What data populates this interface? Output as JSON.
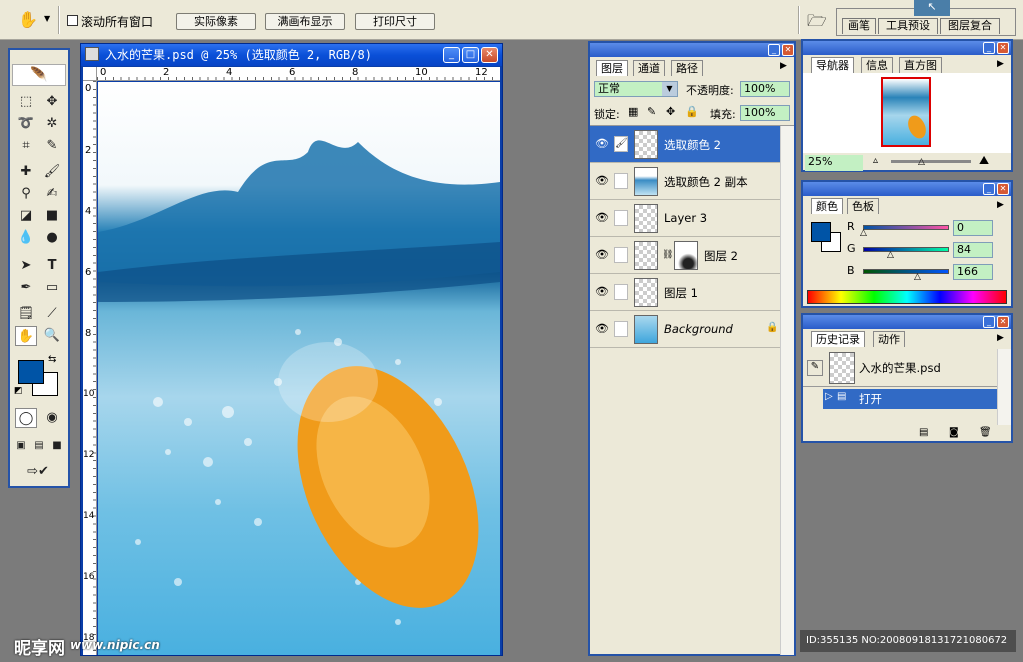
{
  "options_bar": {
    "scroll_all_label": "滚动所有窗口",
    "actual_pixels": "实际像素",
    "fit_screen": "满画布显示",
    "print_size": "打印尺寸",
    "well_tabs": [
      "画笔",
      "工具预设",
      "图层复合"
    ]
  },
  "document": {
    "title": "入水的芒果.psd @ 25% (选取颜色 2, RGB/8)",
    "ruler_top": [
      "0",
      "2",
      "4",
      "6",
      "8",
      "10",
      "12"
    ],
    "ruler_left": [
      "0",
      "2",
      "4",
      "6",
      "8",
      "10",
      "12",
      "14",
      "16",
      "18"
    ]
  },
  "layers_panel": {
    "tabs": [
      "图层",
      "通道",
      "路径"
    ],
    "blend_mode": "正常",
    "opacity_label": "不透明度:",
    "opacity_value": "100%",
    "lock_label": "锁定:",
    "fill_label": "填充:",
    "fill_value": "100%",
    "layers": [
      {
        "name": "选取颜色 2",
        "selected": true
      },
      {
        "name": "选取颜色 2 副本",
        "selected": false
      },
      {
        "name": "Layer 3",
        "selected": false
      },
      {
        "name": "图层 2",
        "selected": false
      },
      {
        "name": "图层 1",
        "selected": false
      },
      {
        "name": "Background",
        "selected": false
      }
    ]
  },
  "navigator_panel": {
    "tabs": [
      "导航器",
      "信息",
      "直方图"
    ],
    "zoom": "25%"
  },
  "color_panel": {
    "tabs": [
      "颜色",
      "色板"
    ],
    "r_label": "R",
    "r_value": "0",
    "g_label": "G",
    "g_value": "84",
    "b_label": "B",
    "b_value": "166",
    "foreground": "#0054a6"
  },
  "history_panel": {
    "tabs": [
      "历史记录",
      "动作"
    ],
    "snapshot": "入水的芒果.psd",
    "steps": [
      "打开"
    ]
  },
  "watermark": {
    "logo": "昵享网",
    "url": "www.nipic.cn",
    "id_text": "ID:355135 NO:20080918131721080672"
  },
  "colors": {
    "titlebar": "#0a50d8",
    "selection": "#316ac5",
    "panel_bg": "#ece9d8"
  }
}
